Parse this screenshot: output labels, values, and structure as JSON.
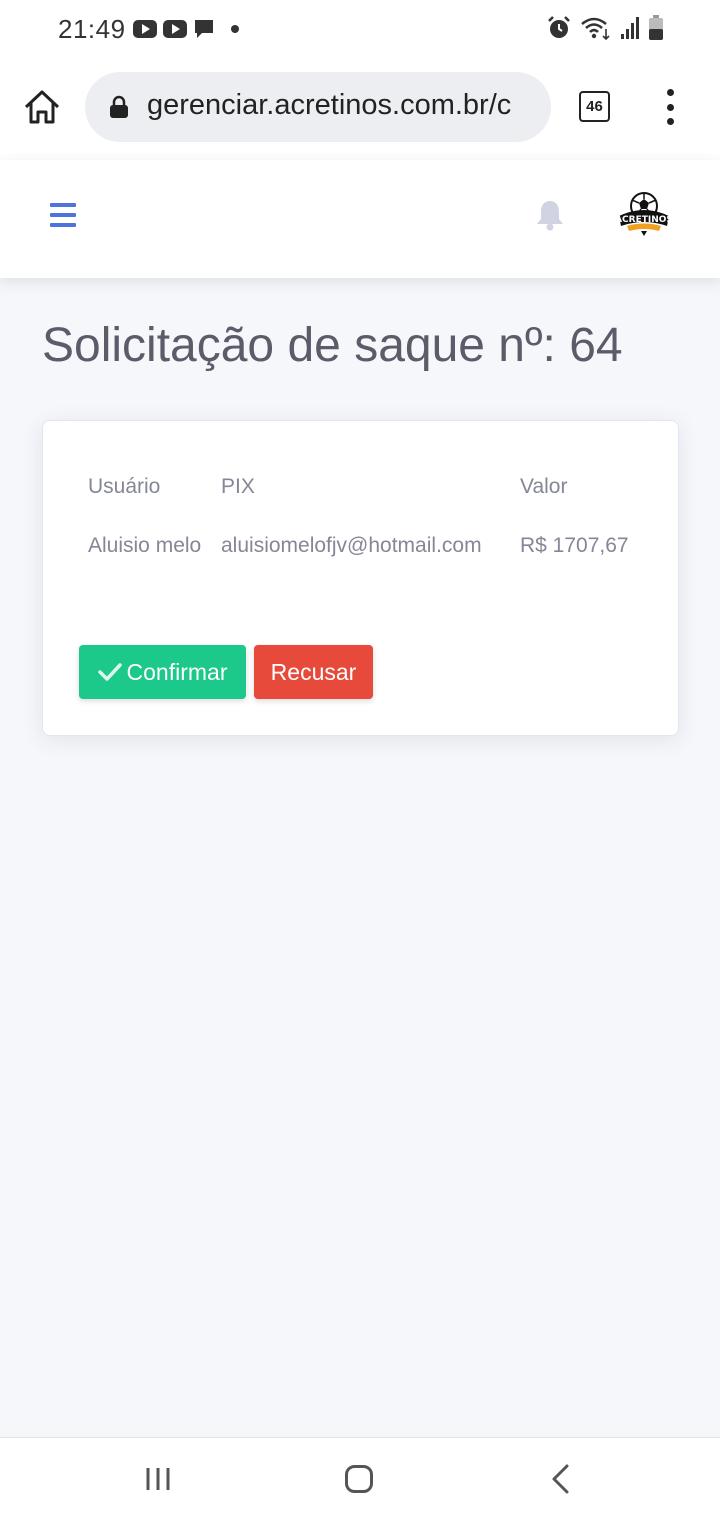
{
  "status_bar": {
    "time": "21:49",
    "icons": [
      "youtube-notification-icon",
      "youtube-notification-icon",
      "message-icon",
      "dot-icon",
      "alarm-icon",
      "wifi-icon",
      "signal-icon",
      "battery-icon"
    ]
  },
  "browser": {
    "url": "gerenciar.acretinos.com.br/c",
    "tab_count": "46",
    "icons": [
      "home-icon",
      "lock-icon",
      "more-vert-icon"
    ]
  },
  "topbar": {
    "icons": [
      "hamburger-icon",
      "bell-icon"
    ],
    "logo_text": "ACRETINOS",
    "accent_color": "#4e73df"
  },
  "page": {
    "title": "Solicitação de saque nº: 64"
  },
  "table": {
    "headers": [
      "Usuário",
      "PIX",
      "Valor"
    ],
    "rows": [
      [
        "Aluisio melo",
        "aluisiomelofjv@hotmail.com",
        "R$ 1707,67"
      ]
    ]
  },
  "actions": {
    "confirm_label": "Confirmar",
    "confirm_color": "#1cc88a",
    "reject_label": "Recusar",
    "reject_color": "#e74a3b"
  },
  "nav_bar": {
    "icons": [
      "recent-apps-icon",
      "home-icon",
      "back-icon"
    ]
  }
}
